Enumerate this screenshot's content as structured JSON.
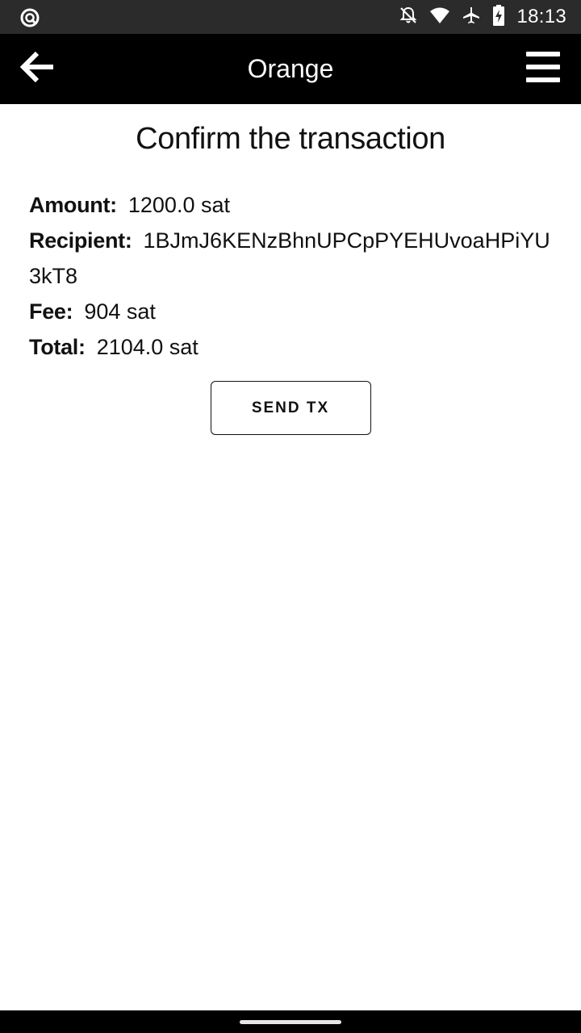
{
  "status_bar": {
    "time": "18:13",
    "icons": [
      "data-saver-icon",
      "notifications-off-icon",
      "wifi-icon",
      "airplane-icon",
      "battery-charging-icon"
    ]
  },
  "app_bar": {
    "title": "Orange",
    "back_icon": "arrow-left-icon",
    "menu_icon": "hamburger-menu-icon"
  },
  "confirm": {
    "heading": "Confirm the transaction",
    "amount_label": "Amount:",
    "amount_value": "1200.0 sat",
    "recipient_label": "Recipient:",
    "recipient_value": "1BJmJ6KENzBhnUPCpPYEHUvoaHPiYU3kT8",
    "fee_label": "Fee:",
    "fee_value": "904 sat",
    "total_label": "Total:",
    "total_value": "2104.0 sat",
    "send_button": "SEND TX"
  },
  "colors": {
    "status_bar": "#2b2b2b",
    "app_bar": "#000000",
    "background": "#ffffff",
    "text": "#111111"
  }
}
